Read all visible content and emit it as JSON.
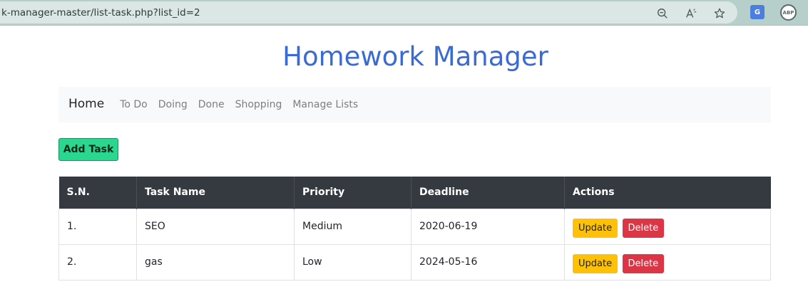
{
  "browser": {
    "url": "k-manager-master/list-task.php?list_id=2",
    "icons": [
      "zoom-out-icon",
      "read-aloud-icon",
      "favorite-star-icon",
      "translate-extension-icon",
      "adblock-plus-icon"
    ],
    "translate_label": "G",
    "abp_label": "ABP"
  },
  "header": {
    "title": "Homework Manager"
  },
  "nav": {
    "brand": "Home",
    "links": [
      "To Do",
      "Doing",
      "Done",
      "Shopping",
      "Manage Lists"
    ]
  },
  "actions": {
    "add_task_label": "Add Task"
  },
  "table": {
    "columns": [
      "S.N.",
      "Task Name",
      "Priority",
      "Deadline",
      "Actions"
    ],
    "rows": [
      {
        "sn": "1.",
        "name": "SEO",
        "priority": "Medium",
        "deadline": "2020-06-19",
        "update": "Update",
        "delete": "Delete"
      },
      {
        "sn": "2.",
        "name": "gas",
        "priority": "Low",
        "deadline": "2024-05-16",
        "update": "Update",
        "delete": "Delete"
      }
    ]
  },
  "colors": {
    "title": "#3a6ad3",
    "add_button": "#2bd68f",
    "header_bg": "#343a40",
    "update_button": "#ffc107",
    "delete_button": "#dc3545"
  }
}
